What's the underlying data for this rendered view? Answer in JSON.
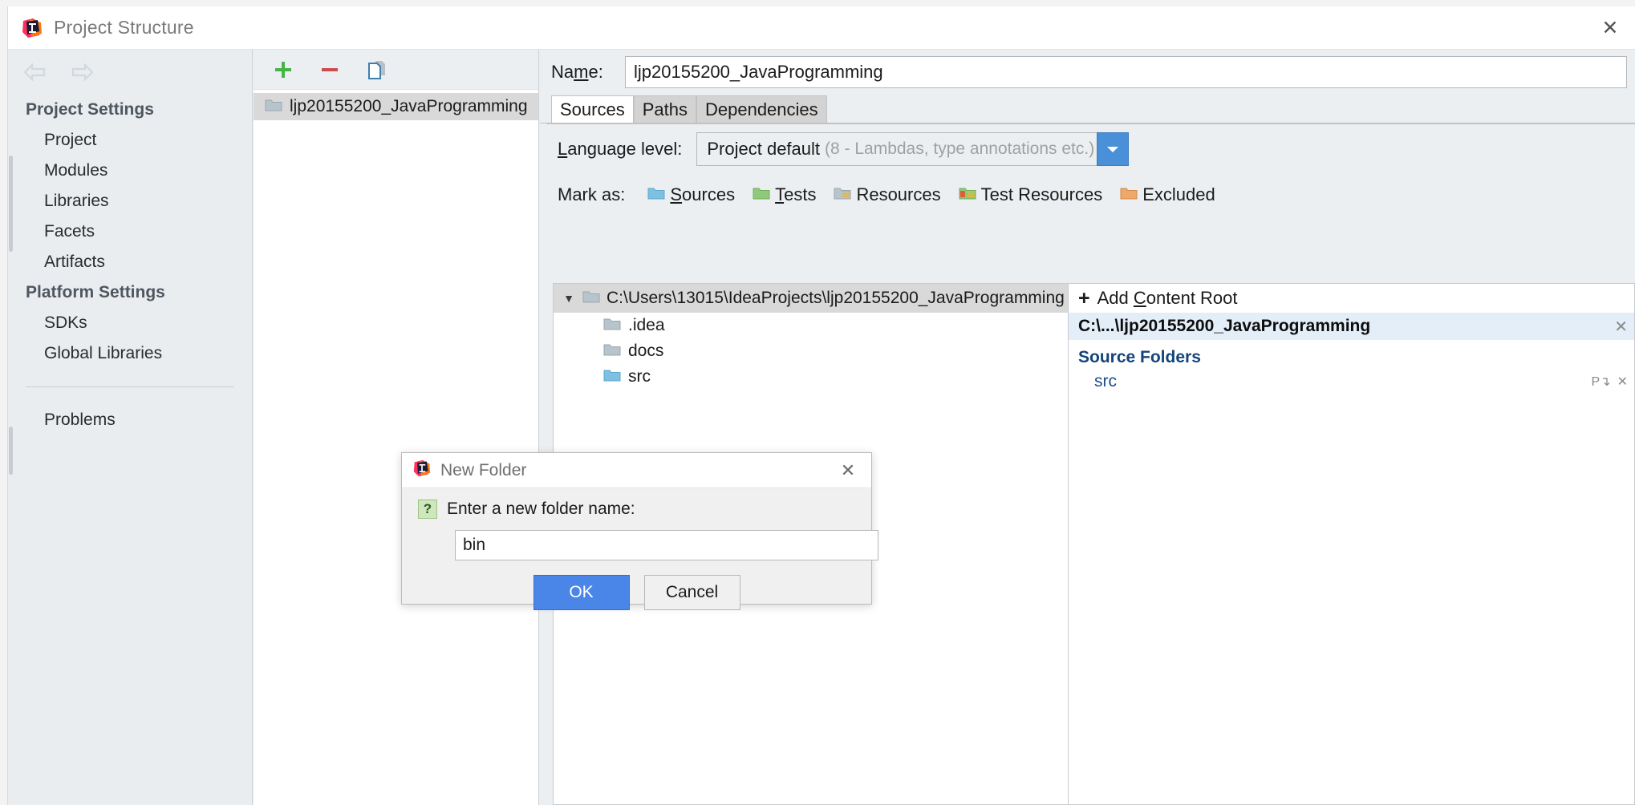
{
  "window": {
    "title": "Project Structure",
    "icon": "intellij-idea-logo",
    "close_label": "✕"
  },
  "nav": {
    "back_icon": "arrow-left-icon",
    "forward_icon": "arrow-right-icon"
  },
  "sidebar": {
    "sections": [
      {
        "title": "Project Settings",
        "items": [
          "Project",
          "Modules",
          "Libraries",
          "Facets",
          "Artifacts"
        ]
      },
      {
        "title": "Platform Settings",
        "items": [
          "SDKs",
          "Global Libraries"
        ]
      }
    ],
    "footer_items": [
      "Problems"
    ]
  },
  "module_toolbar": {
    "add_label": "+",
    "remove_label": "−",
    "copy_label": "copy-icon"
  },
  "module_list": {
    "items": [
      {
        "label": "ljp20155200_JavaProgramming",
        "icon": "module-folder-icon",
        "selected": true
      }
    ]
  },
  "main": {
    "name_label": "Name:",
    "name_value": "ljp20155200_JavaProgramming",
    "tabs": [
      {
        "label": "Sources",
        "active": true
      },
      {
        "label": "Paths",
        "active": false
      },
      {
        "label": "Dependencies",
        "active": false
      }
    ],
    "language_level": {
      "label": "Language level:",
      "value": "Project default",
      "hint": "(8 - Lambdas, type annotations etc.)",
      "arrow_icon": "chevron-down-icon",
      "arrow_color": "#4a90d9"
    },
    "mark_as": {
      "label": "Mark as:",
      "options": [
        {
          "label": "Sources",
          "mnemonic": "S",
          "color": "#7ec0e0"
        },
        {
          "label": "Tests",
          "mnemonic": "T",
          "color": "#8fc97a"
        },
        {
          "label": "Resources",
          "mnemonic": "",
          "color": "#b8c4cc"
        },
        {
          "label": "Test Resources",
          "mnemonic": "",
          "color": "#8fc97a"
        },
        {
          "label": "Excluded",
          "mnemonic": "",
          "color": "#f0a868"
        }
      ]
    },
    "content_tree": {
      "root": {
        "label": "C:\\Users\\13015\\IdeaProjects\\ljp20155200_JavaProgramming",
        "icon": "folder-icon",
        "twisty": "▼"
      },
      "children": [
        {
          "label": ".idea",
          "icon": "folder-icon",
          "color": "#b8c4cc"
        },
        {
          "label": "docs",
          "icon": "folder-icon",
          "color": "#b8c4cc"
        },
        {
          "label": "src",
          "icon": "folder-icon",
          "color": "#7ec0e0"
        }
      ]
    },
    "right_panel": {
      "add_content_root": {
        "label": "Add Content Root",
        "mnemonic": "C",
        "plus": "+"
      },
      "root_entry": {
        "label": "C:\\...\\ljp20155200_JavaProgramming",
        "remove_icon": "x-icon"
      },
      "source_folders_title": "Source Folders",
      "source_folders": [
        {
          "label": "src",
          "icons": [
            "properties-icon",
            "x-icon"
          ]
        }
      ]
    }
  },
  "modal": {
    "title": "New Folder",
    "icon": "intellij-idea-logo",
    "close_label": "✕",
    "question_icon": "?",
    "prompt": "Enter a new folder name:",
    "input_value": "bin",
    "input_placeholder": "",
    "ok_label": "OK",
    "cancel_label": "Cancel"
  }
}
